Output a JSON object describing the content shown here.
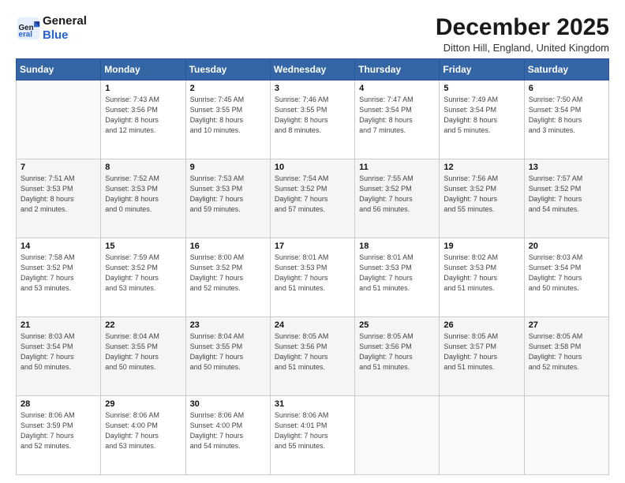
{
  "header": {
    "logo_line1": "General",
    "logo_line2": "Blue",
    "month_title": "December 2025",
    "location": "Ditton Hill, England, United Kingdom"
  },
  "days_of_week": [
    "Sunday",
    "Monday",
    "Tuesday",
    "Wednesday",
    "Thursday",
    "Friday",
    "Saturday"
  ],
  "weeks": [
    [
      {
        "day": "",
        "info": ""
      },
      {
        "day": "1",
        "info": "Sunrise: 7:43 AM\nSunset: 3:56 PM\nDaylight: 8 hours\nand 12 minutes."
      },
      {
        "day": "2",
        "info": "Sunrise: 7:45 AM\nSunset: 3:55 PM\nDaylight: 8 hours\nand 10 minutes."
      },
      {
        "day": "3",
        "info": "Sunrise: 7:46 AM\nSunset: 3:55 PM\nDaylight: 8 hours\nand 8 minutes."
      },
      {
        "day": "4",
        "info": "Sunrise: 7:47 AM\nSunset: 3:54 PM\nDaylight: 8 hours\nand 7 minutes."
      },
      {
        "day": "5",
        "info": "Sunrise: 7:49 AM\nSunset: 3:54 PM\nDaylight: 8 hours\nand 5 minutes."
      },
      {
        "day": "6",
        "info": "Sunrise: 7:50 AM\nSunset: 3:54 PM\nDaylight: 8 hours\nand 3 minutes."
      }
    ],
    [
      {
        "day": "7",
        "info": "Sunrise: 7:51 AM\nSunset: 3:53 PM\nDaylight: 8 hours\nand 2 minutes."
      },
      {
        "day": "8",
        "info": "Sunrise: 7:52 AM\nSunset: 3:53 PM\nDaylight: 8 hours\nand 0 minutes."
      },
      {
        "day": "9",
        "info": "Sunrise: 7:53 AM\nSunset: 3:53 PM\nDaylight: 7 hours\nand 59 minutes."
      },
      {
        "day": "10",
        "info": "Sunrise: 7:54 AM\nSunset: 3:52 PM\nDaylight: 7 hours\nand 57 minutes."
      },
      {
        "day": "11",
        "info": "Sunrise: 7:55 AM\nSunset: 3:52 PM\nDaylight: 7 hours\nand 56 minutes."
      },
      {
        "day": "12",
        "info": "Sunrise: 7:56 AM\nSunset: 3:52 PM\nDaylight: 7 hours\nand 55 minutes."
      },
      {
        "day": "13",
        "info": "Sunrise: 7:57 AM\nSunset: 3:52 PM\nDaylight: 7 hours\nand 54 minutes."
      }
    ],
    [
      {
        "day": "14",
        "info": "Sunrise: 7:58 AM\nSunset: 3:52 PM\nDaylight: 7 hours\nand 53 minutes."
      },
      {
        "day": "15",
        "info": "Sunrise: 7:59 AM\nSunset: 3:52 PM\nDaylight: 7 hours\nand 53 minutes."
      },
      {
        "day": "16",
        "info": "Sunrise: 8:00 AM\nSunset: 3:52 PM\nDaylight: 7 hours\nand 52 minutes."
      },
      {
        "day": "17",
        "info": "Sunrise: 8:01 AM\nSunset: 3:53 PM\nDaylight: 7 hours\nand 51 minutes."
      },
      {
        "day": "18",
        "info": "Sunrise: 8:01 AM\nSunset: 3:53 PM\nDaylight: 7 hours\nand 51 minutes."
      },
      {
        "day": "19",
        "info": "Sunrise: 8:02 AM\nSunset: 3:53 PM\nDaylight: 7 hours\nand 51 minutes."
      },
      {
        "day": "20",
        "info": "Sunrise: 8:03 AM\nSunset: 3:54 PM\nDaylight: 7 hours\nand 50 minutes."
      }
    ],
    [
      {
        "day": "21",
        "info": "Sunrise: 8:03 AM\nSunset: 3:54 PM\nDaylight: 7 hours\nand 50 minutes."
      },
      {
        "day": "22",
        "info": "Sunrise: 8:04 AM\nSunset: 3:55 PM\nDaylight: 7 hours\nand 50 minutes."
      },
      {
        "day": "23",
        "info": "Sunrise: 8:04 AM\nSunset: 3:55 PM\nDaylight: 7 hours\nand 50 minutes."
      },
      {
        "day": "24",
        "info": "Sunrise: 8:05 AM\nSunset: 3:56 PM\nDaylight: 7 hours\nand 51 minutes."
      },
      {
        "day": "25",
        "info": "Sunrise: 8:05 AM\nSunset: 3:56 PM\nDaylight: 7 hours\nand 51 minutes."
      },
      {
        "day": "26",
        "info": "Sunrise: 8:05 AM\nSunset: 3:57 PM\nDaylight: 7 hours\nand 51 minutes."
      },
      {
        "day": "27",
        "info": "Sunrise: 8:05 AM\nSunset: 3:58 PM\nDaylight: 7 hours\nand 52 minutes."
      }
    ],
    [
      {
        "day": "28",
        "info": "Sunrise: 8:06 AM\nSunset: 3:59 PM\nDaylight: 7 hours\nand 52 minutes."
      },
      {
        "day": "29",
        "info": "Sunrise: 8:06 AM\nSunset: 4:00 PM\nDaylight: 7 hours\nand 53 minutes."
      },
      {
        "day": "30",
        "info": "Sunrise: 8:06 AM\nSunset: 4:00 PM\nDaylight: 7 hours\nand 54 minutes."
      },
      {
        "day": "31",
        "info": "Sunrise: 8:06 AM\nSunset: 4:01 PM\nDaylight: 7 hours\nand 55 minutes."
      },
      {
        "day": "",
        "info": ""
      },
      {
        "day": "",
        "info": ""
      },
      {
        "day": "",
        "info": ""
      }
    ]
  ]
}
